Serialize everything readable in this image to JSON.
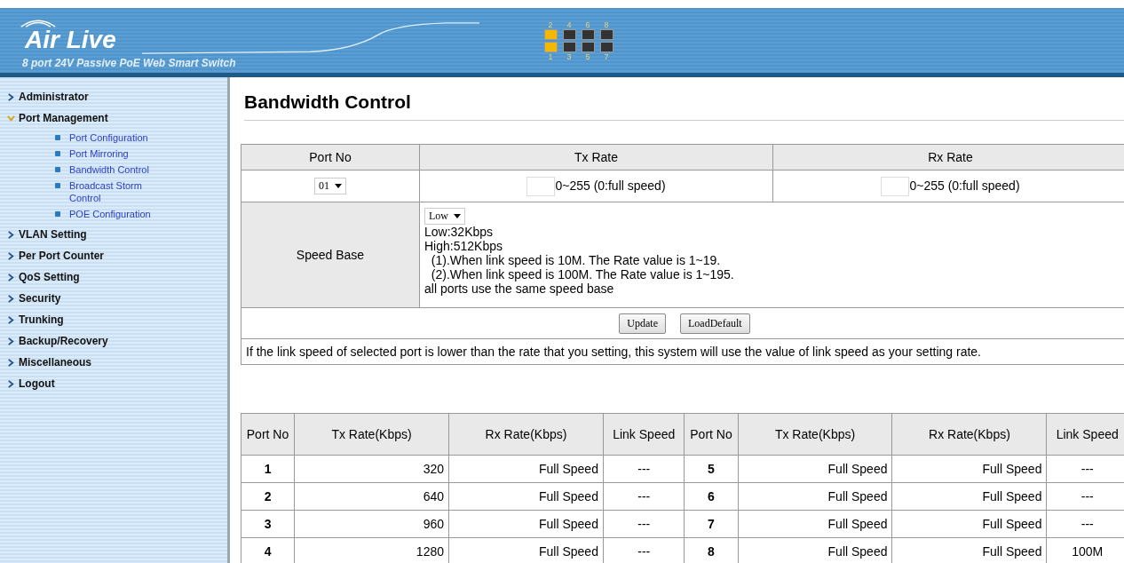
{
  "header": {
    "brand": "Air Live",
    "subtitle": "8 port 24V Passive PoE Web Smart Switch",
    "ports_top": [
      {
        "label": "2",
        "active": true
      },
      {
        "label": "4",
        "active": false
      },
      {
        "label": "6",
        "active": false
      },
      {
        "label": "8",
        "active": false
      }
    ],
    "ports_bottom": [
      {
        "label": "1",
        "active": true
      },
      {
        "label": "3",
        "active": false
      },
      {
        "label": "5",
        "active": false
      },
      {
        "label": "7",
        "active": false
      }
    ]
  },
  "sidebar": {
    "items": [
      {
        "label": "Administrator",
        "expanded": false
      },
      {
        "label": "Port Management",
        "expanded": true,
        "children": [
          {
            "label": "Port Configuration"
          },
          {
            "label": "Port Mirroring"
          },
          {
            "label": "Bandwidth Control"
          },
          {
            "label": "Broadcast Storm Control"
          },
          {
            "label": "POE Configuration"
          }
        ]
      },
      {
        "label": "VLAN Setting",
        "expanded": false
      },
      {
        "label": "Per Port Counter",
        "expanded": false
      },
      {
        "label": "QoS Setting",
        "expanded": false
      },
      {
        "label": "Security",
        "expanded": false
      },
      {
        "label": "Trunking",
        "expanded": false
      },
      {
        "label": "Backup/Recovery",
        "expanded": false
      },
      {
        "label": "Miscellaneous",
        "expanded": false
      },
      {
        "label": "Logout",
        "expanded": false
      }
    ]
  },
  "page_title": "Bandwidth Control",
  "config": {
    "columns": [
      "Port No",
      "Tx Rate",
      "Rx Rate"
    ],
    "port_select": "01",
    "tx_range": "0~255 (0:full speed)",
    "rx_range": "0~255 (0:full speed)",
    "speed_base_label": "Speed Base",
    "speed_base_select": "Low",
    "speed_base_notes": [
      "Low:32Kbps",
      "High:512Kbps",
      "  (1).When link speed is 10M. The Rate value is 1~19.",
      "  (2).When link speed is 100M. The Rate value is 1~195.",
      "all ports use the same speed base"
    ],
    "buttons": [
      "Update",
      "LoadDefault"
    ],
    "note": "If the link speed of selected port is lower than the rate that you setting, this system will use the value of link speed as your setting rate."
  },
  "stats": {
    "columns": [
      "Port No",
      "Tx  Rate(Kbps)",
      "Rx  Rate(Kbps)",
      "Link Speed",
      "Port No",
      "Tx  Rate(Kbps)",
      "Rx  Rate(Kbps)",
      "Link Speed"
    ],
    "rows": [
      [
        "1",
        "320",
        "Full Speed",
        "---",
        "5",
        "Full Speed",
        "Full Speed",
        "---"
      ],
      [
        "2",
        "640",
        "Full Speed",
        "---",
        "6",
        "Full Speed",
        "Full Speed",
        "---"
      ],
      [
        "3",
        "960",
        "Full Speed",
        "---",
        "7",
        "Full Speed",
        "Full Speed",
        "---"
      ],
      [
        "4",
        "1280",
        "Full Speed",
        "---",
        "8",
        "Full Speed",
        "Full Speed",
        "100M"
      ]
    ]
  }
}
